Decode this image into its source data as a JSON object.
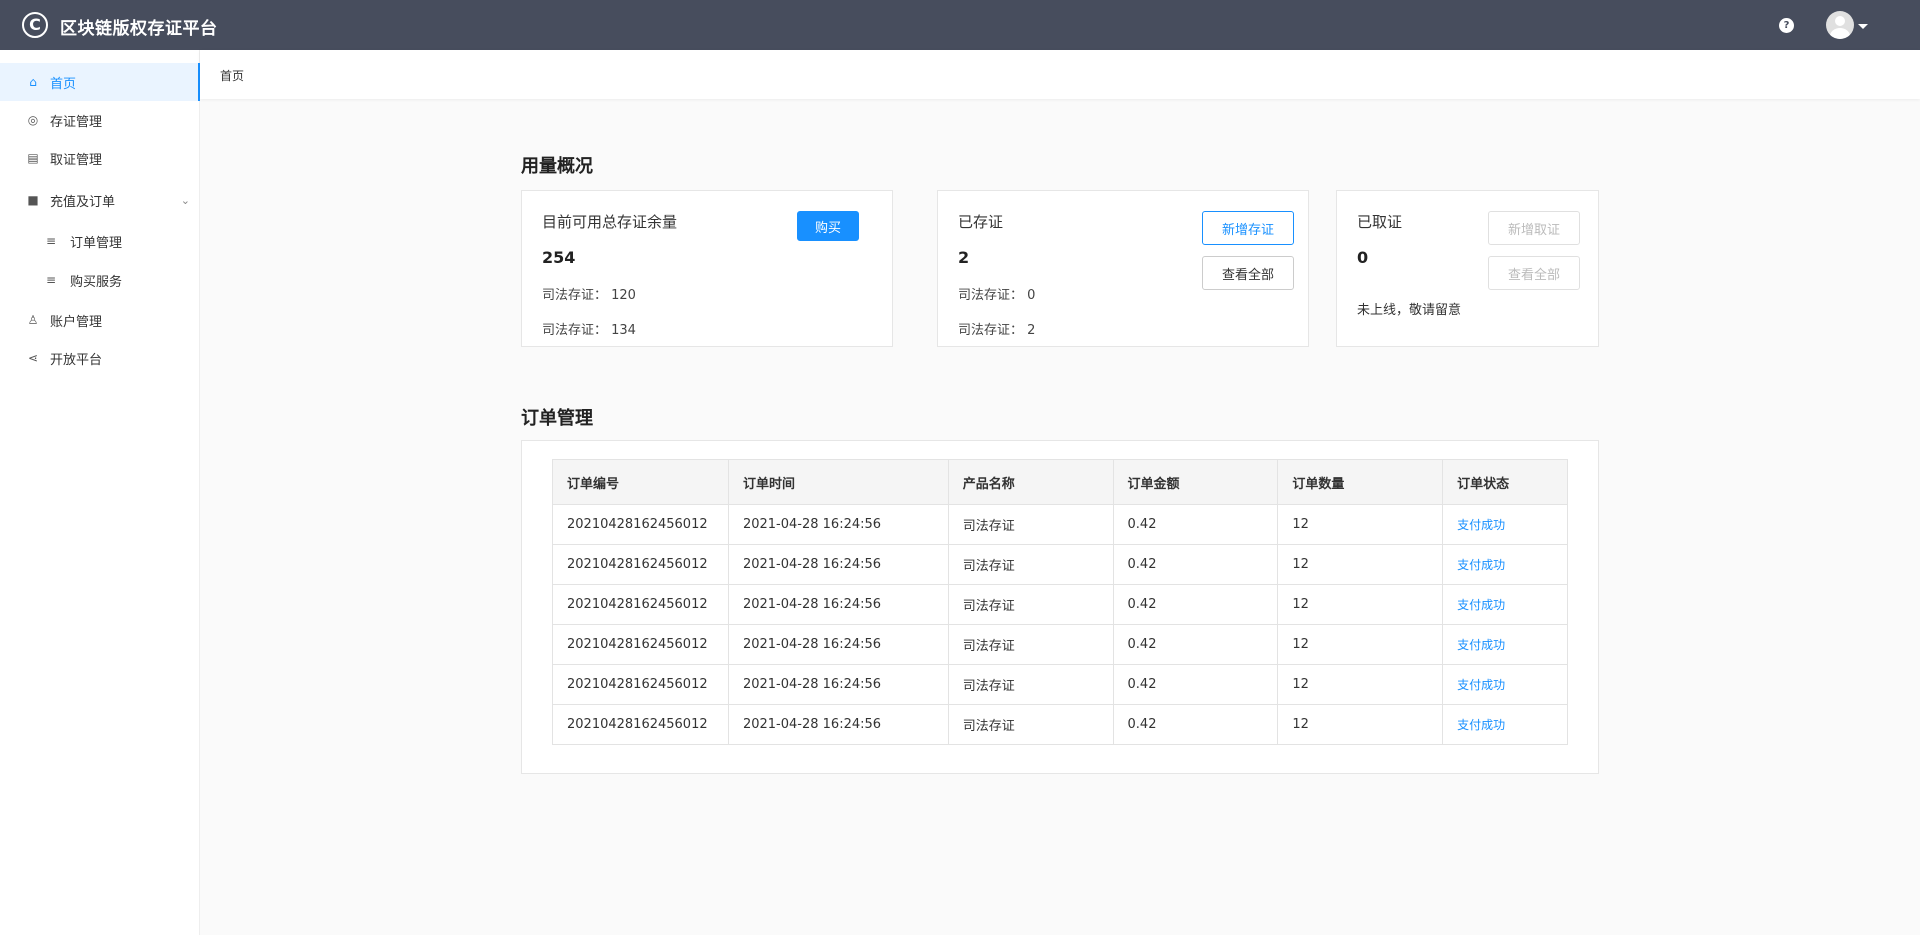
{
  "app": {
    "logo_glyph": "C",
    "title": "区块链版权存证平台"
  },
  "header": {
    "help_glyph": "?"
  },
  "sidebar": {
    "items": [
      {
        "label": "首页",
        "icon": "home-icon",
        "glyph": "⌂"
      },
      {
        "label": "存证管理",
        "icon": "target-icon",
        "glyph": "◎"
      },
      {
        "label": "取证管理",
        "icon": "document-icon",
        "glyph": "▤"
      },
      {
        "label": "充值及订单",
        "icon": "briefcase-icon",
        "glyph": "■",
        "chevron": "⌄"
      },
      {
        "label": "订单管理",
        "icon": "list-icon",
        "glyph": "≡"
      },
      {
        "label": "购买服务",
        "icon": "list-icon",
        "glyph": "≡"
      },
      {
        "label": "账户管理",
        "icon": "user-icon",
        "glyph": "♙"
      },
      {
        "label": "开放平台",
        "icon": "share-icon",
        "glyph": "⋖"
      }
    ]
  },
  "breadcrumb": {
    "current": "首页"
  },
  "usage": {
    "title": "用量概况",
    "available": {
      "title": "目前可用总存证余量",
      "count": "254",
      "buy_label": "购买",
      "line1": "司法存证： 120",
      "line2": "司法存证： 134"
    },
    "stored": {
      "title": "已存证",
      "count": "2",
      "add_label": "新增存证",
      "view_all_label": "查看全部",
      "line1": "司法存证： 0",
      "line2": "司法存证： 2"
    },
    "retrieved": {
      "title": "已取证",
      "count": "0",
      "add_label": "新增取证",
      "view_all_label": "查看全部",
      "notice": "未上线，敬请留意"
    }
  },
  "orders": {
    "title": "订单管理",
    "columns": [
      "订单编号",
      "订单时间",
      "产品名称",
      "订单金额",
      "订单数量",
      "订单状态"
    ],
    "rows": [
      [
        "20210428162456012",
        "2021-04-28 16:24:56",
        "司法存证",
        "0.42",
        "12",
        "支付成功"
      ],
      [
        "20210428162456012",
        "2021-04-28 16:24:56",
        "司法存证",
        "0.42",
        "12",
        "支付成功"
      ],
      [
        "20210428162456012",
        "2021-04-28 16:24:56",
        "司法存证",
        "0.42",
        "12",
        "支付成功"
      ],
      [
        "20210428162456012",
        "2021-04-28 16:24:56",
        "司法存证",
        "0.42",
        "12",
        "支付成功"
      ],
      [
        "20210428162456012",
        "2021-04-28 16:24:56",
        "司法存证",
        "0.42",
        "12",
        "支付成功"
      ],
      [
        "20210428162456012",
        "2021-04-28 16:24:56",
        "司法存证",
        "0.42",
        "12",
        "支付成功"
      ]
    ]
  },
  "colors": {
    "accent": "#1890ff",
    "topbar": "#474d5d"
  }
}
